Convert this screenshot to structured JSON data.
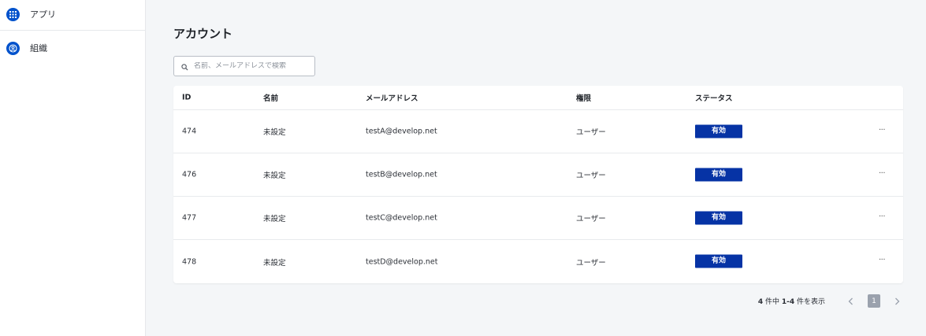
{
  "sidebar": {
    "items": [
      {
        "label": "アプリ",
        "icon": "apps-grid-icon"
      },
      {
        "label": "組織",
        "icon": "organization-icon"
      }
    ]
  },
  "main": {
    "title": "アカウント",
    "search": {
      "placeholder": "名前、メールアドレスで検索",
      "value": ""
    }
  },
  "table": {
    "columns": [
      "ID",
      "名前",
      "メールアドレス",
      "権限",
      "ステータス"
    ],
    "rows": [
      {
        "id": "474",
        "name": "未設定",
        "email": "testA@develop.net",
        "role": "ユーザー",
        "status": "有効",
        "menu": "···"
      },
      {
        "id": "476",
        "name": "未設定",
        "email": "testB@develop.net",
        "role": "ユーザー",
        "status": "有効",
        "menu": "···"
      },
      {
        "id": "477",
        "name": "未設定",
        "email": "testC@develop.net",
        "role": "ユーザー",
        "status": "有効",
        "menu": "···"
      },
      {
        "id": "478",
        "name": "未設定",
        "email": "testD@develop.net",
        "role": "ユーザー",
        "status": "有効",
        "menu": "···"
      }
    ]
  },
  "pagination": {
    "total": "4",
    "text_mid": "件中",
    "range": "1-4",
    "text_end": "件を表示",
    "current_page": "1"
  },
  "colors": {
    "accent": "#0052cc",
    "status_badge": "#0633a5",
    "page_bg": "#f4f6f8"
  }
}
